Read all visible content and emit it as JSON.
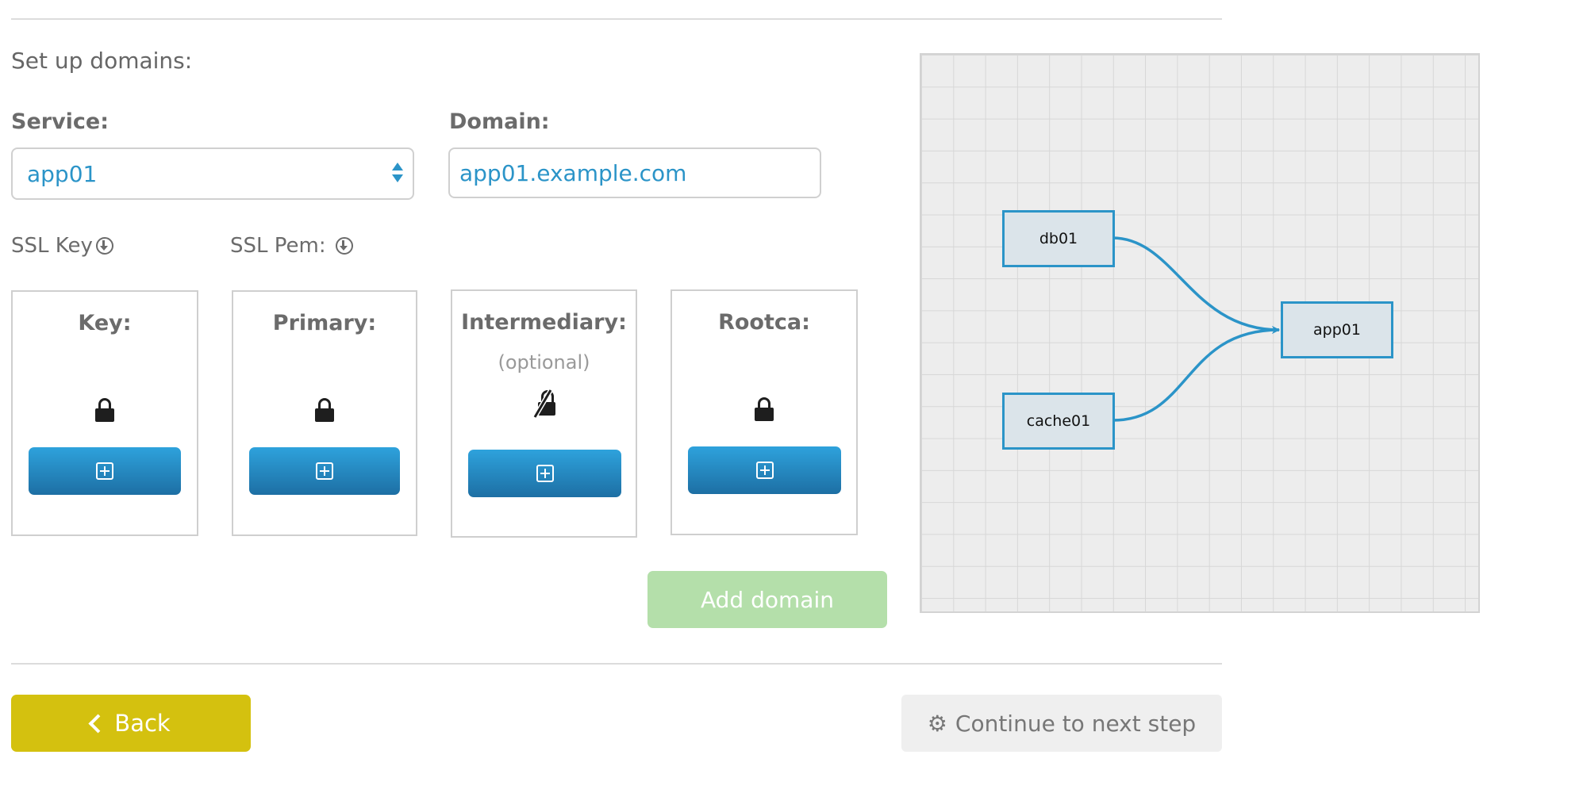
{
  "section_title": "Set up domains:",
  "service": {
    "label": "Service:",
    "value": "app01"
  },
  "domain": {
    "label": "Domain:",
    "value": "app01.example.com"
  },
  "ssl": {
    "key_label": "SSL Key",
    "pem_label": "SSL Pem:"
  },
  "cards": [
    {
      "title": "Key:",
      "icon": "lock-icon"
    },
    {
      "title": "Primary:",
      "icon": "lock-icon"
    },
    {
      "title": "Intermediary:",
      "subtitle": "(optional)",
      "icon": "unlocked-slash-icon"
    },
    {
      "title": "Rootca:",
      "icon": "lock-icon"
    }
  ],
  "add_domain_label": "Add domain",
  "back_label": "Back",
  "continue_label": "Continue to next step",
  "diagram": {
    "nodes": [
      "db01",
      "app01",
      "cache01"
    ],
    "links": [
      {
        "from": "db01",
        "to": "app01"
      },
      {
        "from": "cache01",
        "to": "app01"
      }
    ]
  },
  "colors": {
    "accent": "#2b94c8",
    "back_button": "#d4c10f",
    "add_domain_button": "#b4dfaa",
    "continue_button": "#efefef"
  }
}
